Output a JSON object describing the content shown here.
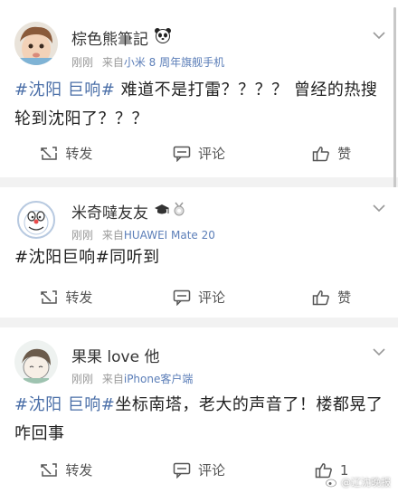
{
  "posts": [
    {
      "username": "棕色熊筆記",
      "time": "刚刚",
      "source_prefix": "来自",
      "source": "小米 8 周年旗舰手机",
      "hashtag": "#沈阳 巨响#",
      "text": " 难道不是打雷？？？？ 曾经的热搜轮到沈阳了？？？"
    },
    {
      "username": "米奇噠友友",
      "time": "刚刚",
      "source_prefix": "来自",
      "source": "HUAWEI Mate 20",
      "hashtag": "#沈阳巨响#",
      "text": "同听到"
    },
    {
      "username": "果果 love 他",
      "time": "刚刚",
      "source_prefix": "来自",
      "source": "iPhone客户端",
      "hashtag": "#沈阳 巨响#",
      "text": "坐标南塔，老大的声音了！楼都晃了咋回事"
    }
  ],
  "actions": {
    "repost": "转发",
    "comment": "评论",
    "like": "赞",
    "like_count_post3": "1"
  },
  "watermark": "@辽沈晚报",
  "icons": [
    "chevron-down-icon",
    "repost-icon",
    "comment-icon",
    "like-icon",
    "panda-icon",
    "grad-cap-icon",
    "medal-icon"
  ],
  "colors": {
    "link": "#4b6fa8",
    "source": "#5b7eb8",
    "meta": "#999999",
    "background": "#f2f2f2"
  }
}
